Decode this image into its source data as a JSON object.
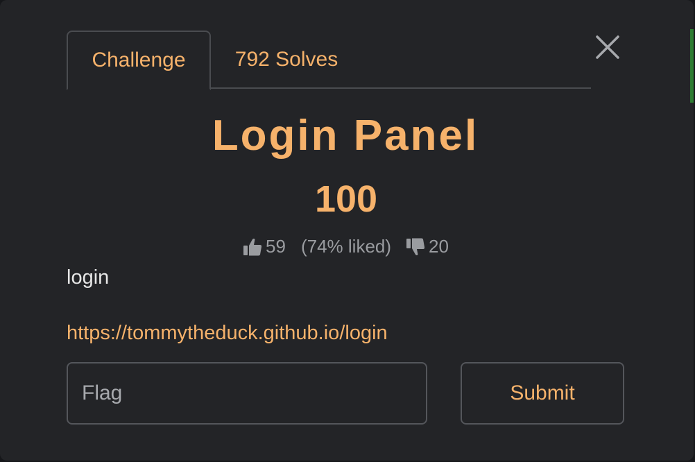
{
  "tabs": [
    {
      "label": "Challenge",
      "active": true
    },
    {
      "label": "792 Solves",
      "active": false
    }
  ],
  "close_icon": "close-icon",
  "challenge": {
    "title": "Login Panel",
    "points": "100",
    "likes": "59",
    "liked_percent": "(74% liked)",
    "dislikes": "20",
    "description": "login",
    "link": "https://tommytheduck.github.io/login"
  },
  "form": {
    "flag_placeholder": "Flag",
    "submit_label": "Submit"
  },
  "colors": {
    "accent": "#f6b26b",
    "background": "#232427",
    "border": "#54565b",
    "muted_text": "#9a9ca0"
  },
  "icons": {
    "like": "thumbs-up-icon",
    "dislike": "thumbs-down-icon"
  }
}
